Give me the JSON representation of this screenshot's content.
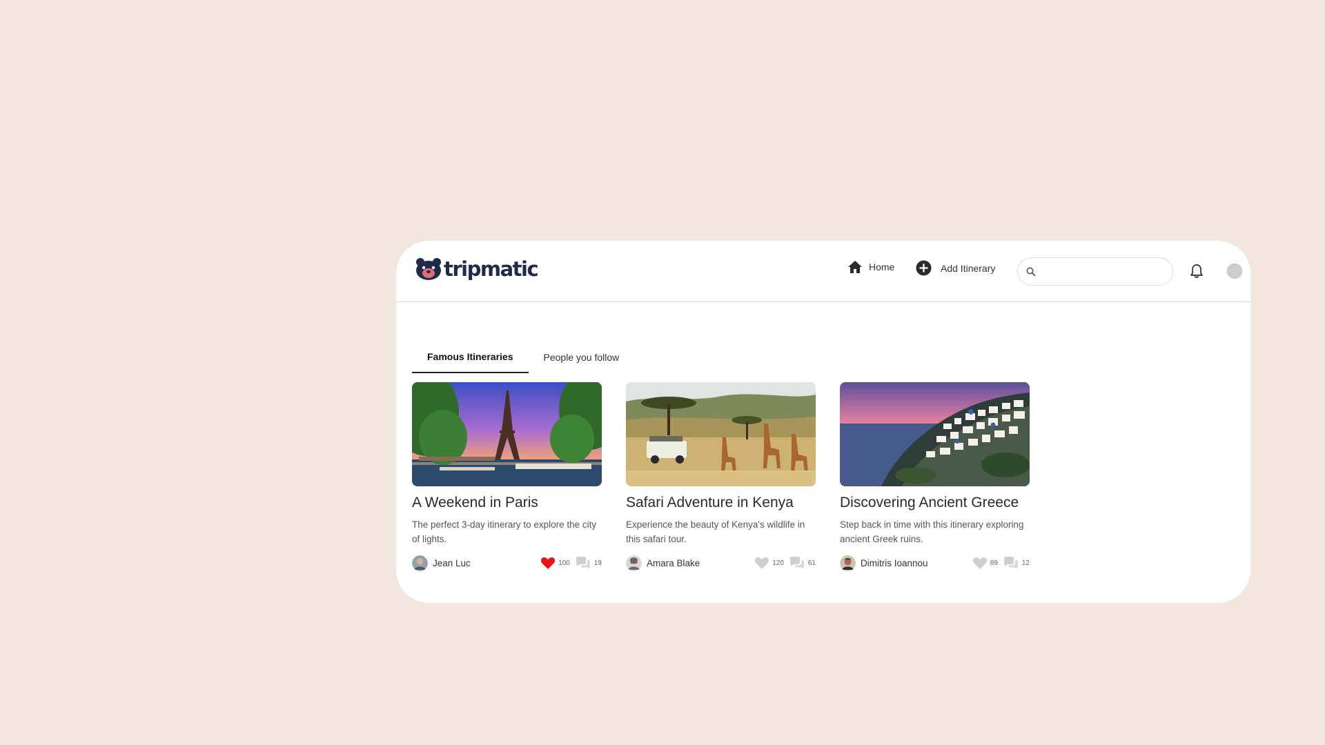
{
  "brand": {
    "name": "tripmatic"
  },
  "nav": {
    "home_label": "Home",
    "add_label": "Add Itinerary",
    "search_placeholder": ""
  },
  "tabs": [
    {
      "label": "Famous Itineraries",
      "active": true
    },
    {
      "label": "People you follow",
      "active": false
    }
  ],
  "cards": [
    {
      "title": "A Weekend in Paris",
      "description": "The perfect 3-day itinerary to explore the city of lights.",
      "author": "Jean Luc",
      "likes": "100",
      "comments": "19",
      "liked": true
    },
    {
      "title": "Safari Adventure in Kenya",
      "description": "Experience the beauty of Kenya's wildlife in this safari tour.",
      "author": "Amara Blake",
      "likes": "120",
      "comments": "61",
      "liked": false
    },
    {
      "title": "Discovering Ancient Greece",
      "description": "Step back in time with this itinerary exploring ancient Greek ruins.",
      "author": "Dimitris Ioannou",
      "likes": "89",
      "comments": "12",
      "liked": false
    }
  ],
  "icons": {
    "home": "home-icon",
    "add": "plus-circle-icon",
    "search": "search-icon",
    "bell": "bell-icon",
    "like": "heart-icon",
    "comment": "comment-icon"
  },
  "colors": {
    "background": "#f3e6df",
    "liked_heart": "#e8141b",
    "unliked_heart": "#cfcfcf",
    "brand": "#1f2b4a"
  }
}
